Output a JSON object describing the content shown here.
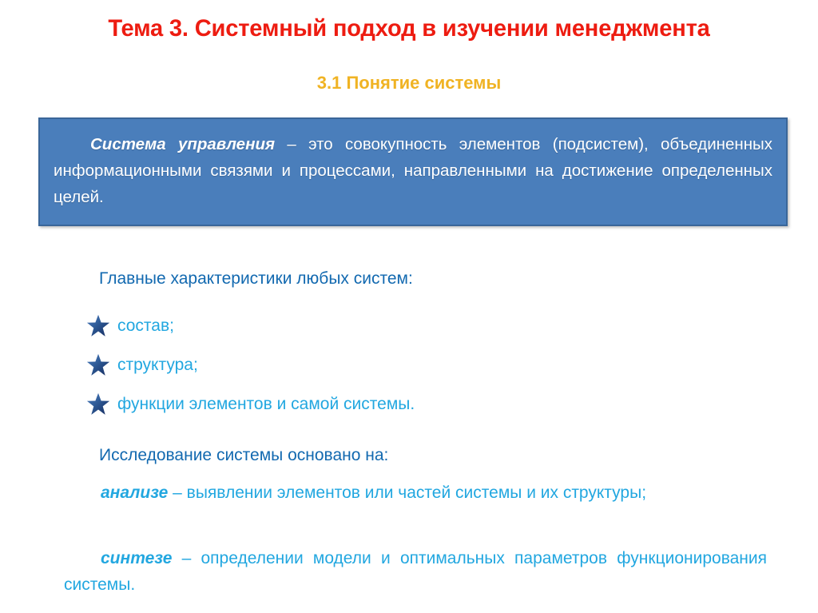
{
  "slide": {
    "title": "Тема 3. Системный подход в изучении менеджмента",
    "subtitle": "3.1 Понятие системы",
    "colors": {
      "title": "#ED1C11",
      "subtitle": "#F0B323",
      "box_fill": "#4A7EBB",
      "box_border": "#3A6699",
      "heading_blue": "#1269B0",
      "body_cyan": "#22A7E0",
      "star_dark": "#1F3864",
      "star_light": "#4472C4",
      "background": "#FFFFFF"
    }
  },
  "definition_box": {
    "term": "Система управления",
    "body": " – это совокупность элементов (подсистем), объединенных информационными связями и процессами, направленными на достижение определенных целей."
  },
  "characteristics": {
    "lead": "Главные характеристики любых систем:",
    "items": [
      {
        "icon": "star-icon",
        "label": "состав;"
      },
      {
        "icon": "star-icon",
        "label": "структура;"
      },
      {
        "icon": "star-icon",
        "label": "функции элементов и самой системы."
      }
    ]
  },
  "research": {
    "lead": "Исследование системы основано на:",
    "paragraphs": [
      {
        "term": "анализе",
        "body": " – выявлении элементов или частей системы и их структуры;"
      },
      {
        "term": "синтезе",
        "body": " – определении модели и оптимальных параметров функционирования системы."
      }
    ]
  }
}
